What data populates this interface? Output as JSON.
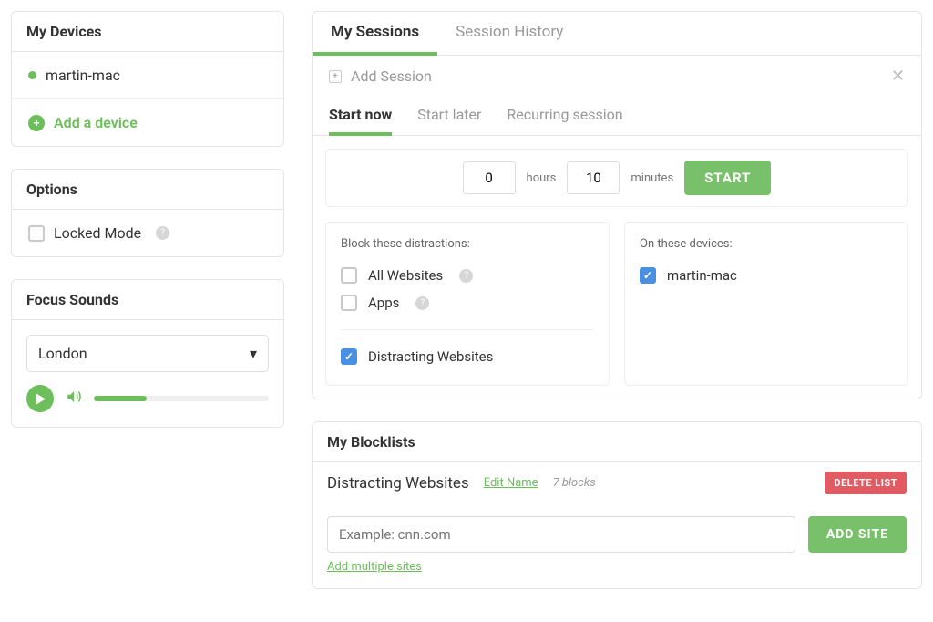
{
  "left": {
    "devices_header": "My Devices",
    "device_name": "martin-mac",
    "add_device": "Add a device",
    "options_header": "Options",
    "locked_mode": "Locked Mode",
    "focus_header": "Focus Sounds",
    "sound_selected": "London"
  },
  "tabs_top": {
    "my_sessions": "My Sessions",
    "session_history": "Session History"
  },
  "session": {
    "add_session": "Add Session",
    "tabs": {
      "start_now": "Start now",
      "start_later": "Start later",
      "recurring": "Recurring session"
    },
    "hours_value": "0",
    "hours_label": "hours",
    "minutes_value": "10",
    "minutes_label": "minutes",
    "start_btn": "START",
    "block_title": "Block these distractions:",
    "all_websites": "All Websites",
    "apps": "Apps",
    "distracting": "Distracting Websites",
    "devices_title": "On these devices:",
    "device_name": "martin-mac"
  },
  "blocklists": {
    "header": "My Blocklists",
    "name": "Distracting Websites",
    "edit": "Edit Name",
    "count": "7 blocks",
    "delete": "DELETE LIST",
    "placeholder": "Example: cnn.com",
    "add_site": "ADD SITE",
    "add_multiple": "Add multiple sites"
  }
}
